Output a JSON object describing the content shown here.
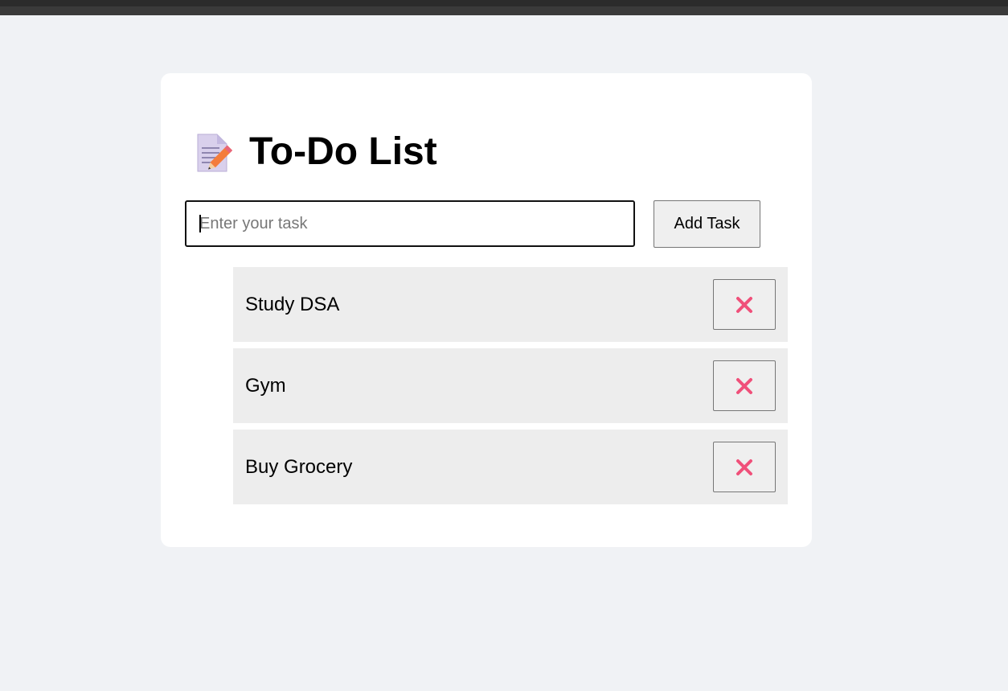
{
  "header": {
    "title": "To-Do List",
    "icon": "memo-icon"
  },
  "form": {
    "input_value": "",
    "input_placeholder": "Enter your task",
    "add_label": "Add Task"
  },
  "tasks": [
    {
      "label": "Study DSA",
      "delete_icon": "close-icon"
    },
    {
      "label": "Gym",
      "delete_icon": "close-icon"
    },
    {
      "label": "Buy Grocery",
      "delete_icon": "close-icon"
    }
  ],
  "colors": {
    "page_background": "#f0f2f5",
    "card_background": "#ffffff",
    "task_background": "#ededed",
    "delete_icon": "#f0507a"
  }
}
